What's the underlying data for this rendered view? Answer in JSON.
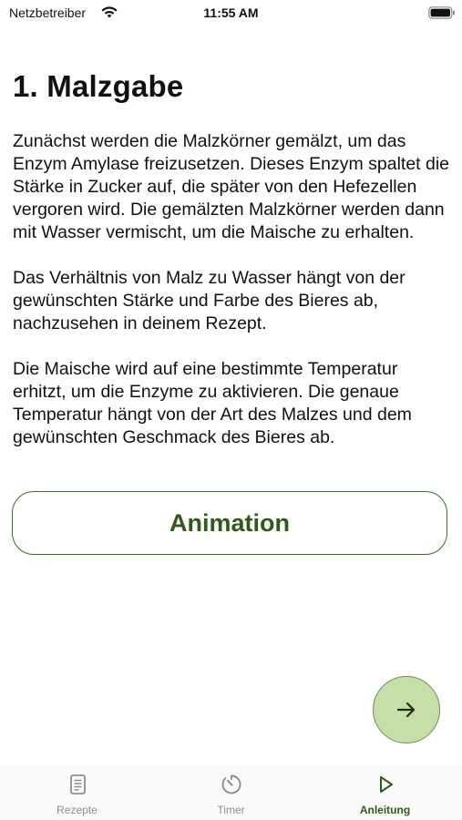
{
  "status_bar": {
    "carrier": "Netzbetreiber",
    "time": "11:55 AM"
  },
  "page": {
    "title": "1. Malzgabe",
    "paragraphs": [
      "Zunächst werden die Malzkörner gemälzt, um das Enzym Amylase freizusetzen. Dieses Enzym spaltet die Stärke in Zucker auf, die später von den Hefezellen vergoren wird. Die gemälzten Malzkörner werden dann mit Wasser vermischt, um die Maische zu erhalten.",
      "Das Verhältnis von Malz zu Wasser hängt von der gewünschten Stärke und Farbe des Bieres ab, nachzusehen in deinem Rezept.",
      "Die Maische wird auf eine bestimmte Temperatur erhitzt, um die Enzyme zu aktivieren. Die genaue Temperatur hängt von der Art des Malzes und dem gewünschten Geschmack des Bieres ab."
    ]
  },
  "buttons": {
    "animation_label": "Animation",
    "next_icon": "arrow-right-icon"
  },
  "tabs": [
    {
      "label": "Rezepte",
      "icon": "recipe-book-icon",
      "active": false
    },
    {
      "label": "Timer",
      "icon": "timer-icon",
      "active": false
    },
    {
      "label": "Anleitung",
      "icon": "play-icon",
      "active": true
    }
  ],
  "colors": {
    "accent": "#2f5a1a",
    "fab_fill": "#c6dfa8",
    "inactive": "#8e8e8e"
  }
}
